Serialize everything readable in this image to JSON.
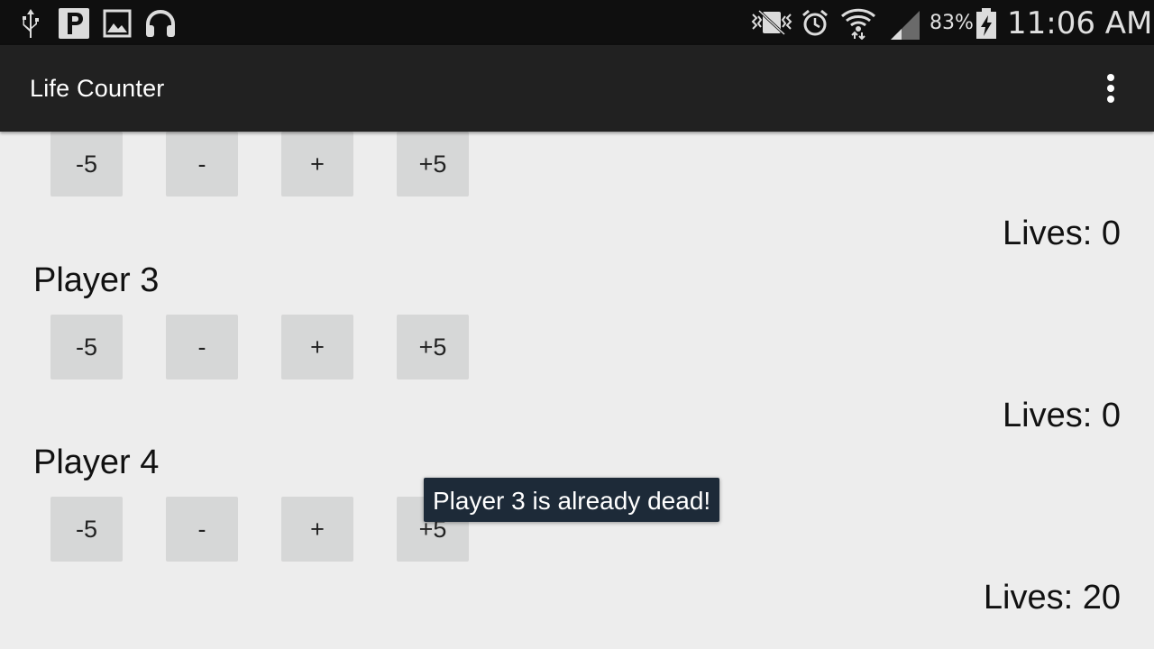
{
  "status_bar": {
    "left_icons": [
      "usb-icon",
      "parking-icon",
      "image-icon",
      "headphones-icon"
    ],
    "right_icons": [
      "vibrate-icon",
      "alarm-icon",
      "wifi-icon",
      "signal-icon",
      "battery-charging-icon"
    ],
    "battery_percent": "83%",
    "time": "11:06 AM"
  },
  "action_bar": {
    "title": "Life Counter",
    "overflow_icon": "overflow-menu-icon"
  },
  "counter_buttons": {
    "minus5": "-5",
    "minus1": "-",
    "plus1": "+",
    "plus5": "+5"
  },
  "players": [
    {
      "name": "",
      "lives_text": "Lives: 0"
    },
    {
      "name": "Player 3",
      "lives_text": "Lives: 0"
    },
    {
      "name": "Player 4",
      "lives_text": "Lives: 20"
    }
  ],
  "toast": {
    "message": "Player 3 is already dead!"
  },
  "colors": {
    "status_bar_bg": "#0f0f0f",
    "action_bar_bg": "#212121",
    "content_bg": "#ededed",
    "button_bg": "#d6d7d7",
    "toast_bg": "#1d2a38"
  }
}
